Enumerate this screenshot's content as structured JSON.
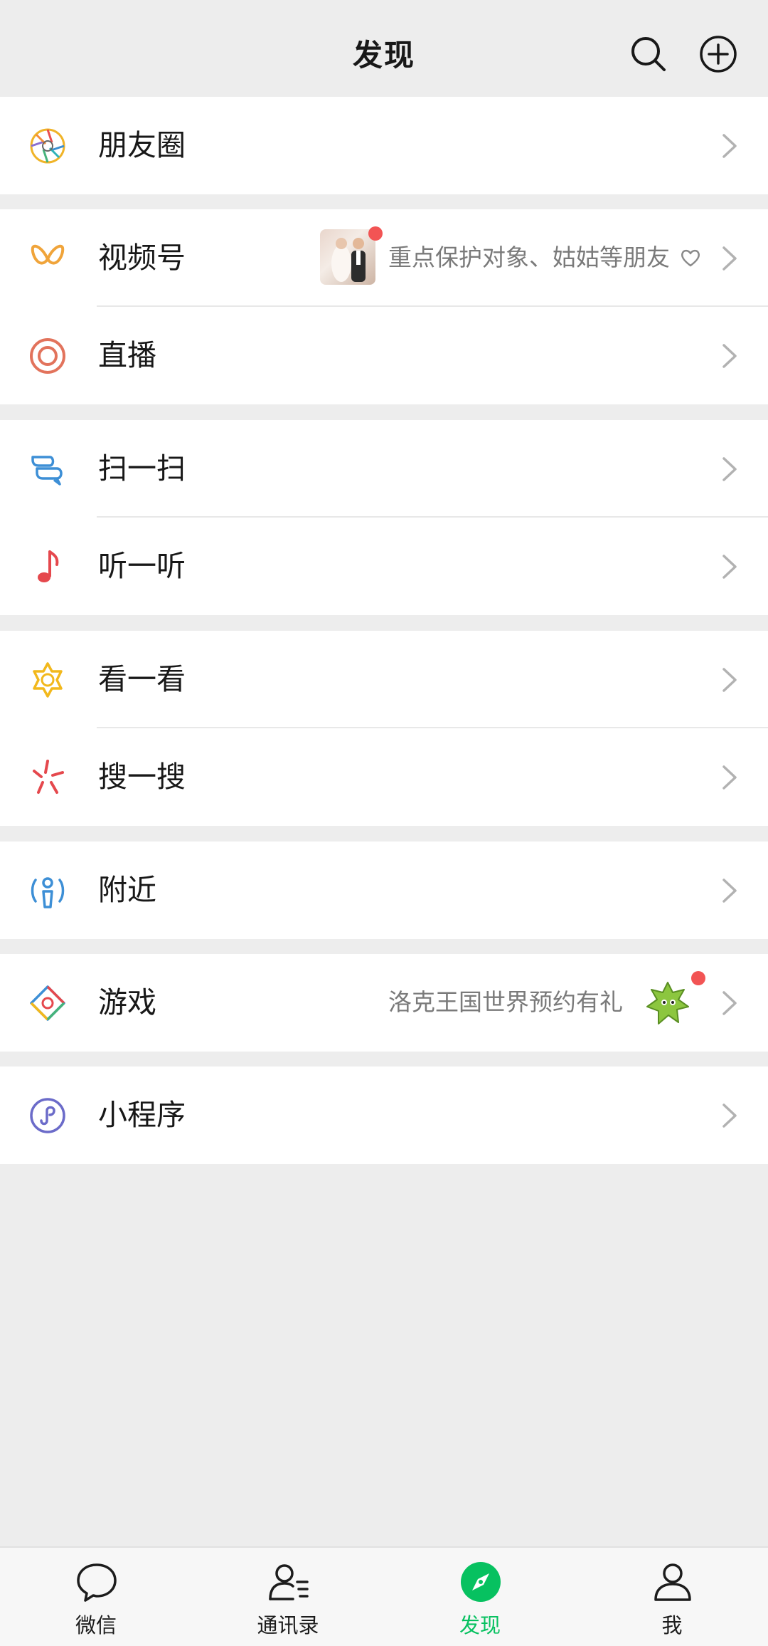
{
  "header": {
    "title": "发现"
  },
  "rows": {
    "moments": {
      "label": "朋友圈"
    },
    "channels": {
      "label": "视频号",
      "subtitle": "重点保护对象、姑姑等朋友"
    },
    "live": {
      "label": "直播"
    },
    "scan": {
      "label": "扫一扫"
    },
    "listen": {
      "label": "听一听"
    },
    "top_stories": {
      "label": "看一看"
    },
    "search": {
      "label": "搜一搜"
    },
    "nearby": {
      "label": "附近"
    },
    "games": {
      "label": "游戏",
      "subtitle": "洛克王国世界预约有礼"
    },
    "mini_programs": {
      "label": "小程序"
    }
  },
  "tabbar": {
    "items": [
      {
        "label": "微信",
        "icon": "chat-icon"
      },
      {
        "label": "通讯录",
        "icon": "contacts-icon"
      },
      {
        "label": "发现",
        "icon": "discover-compass-icon",
        "active": true
      },
      {
        "label": "我",
        "icon": "me-icon"
      }
    ]
  },
  "colors": {
    "accent": "#07c160",
    "badge": "#f25454",
    "background": "#ededed"
  }
}
